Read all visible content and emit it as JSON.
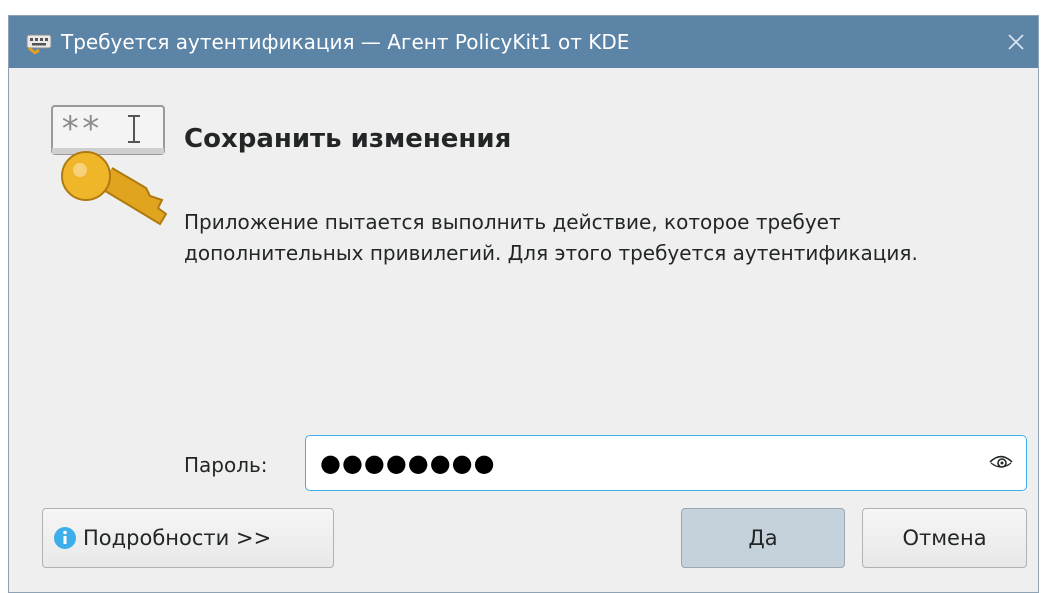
{
  "window": {
    "title": "Требуется аутентификация — Агент PolicyKit1 от KDE",
    "title_icon": "keyboard-icon",
    "close_icon": "close-icon"
  },
  "dialog": {
    "heading": "Сохранить изменения",
    "description": "Приложение пытается выполнить действие, которое требует дополнительных привилегий. Для этого требуется аутентификация.",
    "icon": "password-key-icon",
    "password_label": "Пароль:",
    "password_value": "●●●●●●●●",
    "eye_icon": "eye-icon"
  },
  "buttons": {
    "details_label": "Подробности >>",
    "details_icon": "info-icon",
    "ok_label": "Да",
    "cancel_label": "Отмена"
  },
  "colors": {
    "titlebar": "#5b84a7",
    "window_bg": "#efefef",
    "focus": "#3daee9",
    "default_button": "#c6d2db"
  }
}
